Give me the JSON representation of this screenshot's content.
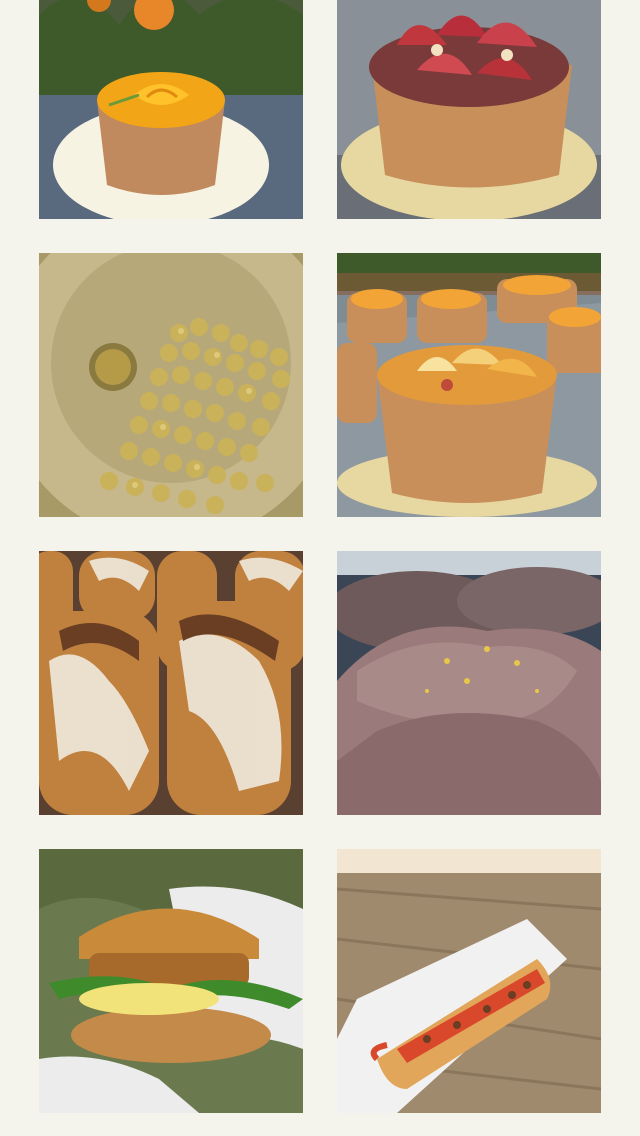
{
  "page": {
    "background": "#f4f4ec"
  },
  "gallery": {
    "tiles": [
      {
        "subject": "mango-rose-tart",
        "accent": "#f2a516"
      },
      {
        "subject": "fig-tart",
        "accent": "#b8323a"
      },
      {
        "subject": "gold-pearls-bowl",
        "accent": "#c9b25a"
      },
      {
        "subject": "fruit-tarts-tray",
        "accent": "#e39a3a"
      },
      {
        "subject": "eclairs-coconut",
        "accent": "#b8743a"
      },
      {
        "subject": "sugared-donut",
        "accent": "#9a7a7a"
      },
      {
        "subject": "chicken-burger",
        "accent": "#c98a3a"
      },
      {
        "subject": "hot-dog-tray",
        "accent": "#d9482a"
      }
    ]
  }
}
